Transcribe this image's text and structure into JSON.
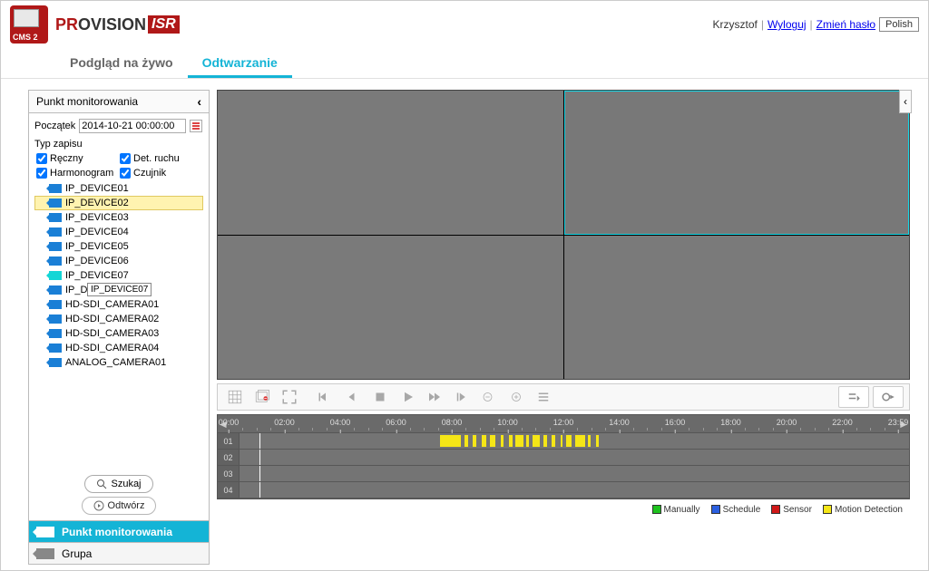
{
  "header": {
    "user": "Krzysztof",
    "logout": "Wyloguj",
    "change_pw": "Zmień hasło",
    "language": "Polish"
  },
  "tabs": {
    "live": "Podgląd na żywo",
    "playback": "Odtwarzanie"
  },
  "sidebar": {
    "title": "Punkt monitorowania",
    "start_label": "Początek",
    "start_value": "2014-10-21 00:00:00",
    "rec_type_label": "Typ zapisu",
    "types": {
      "manual": "Ręczny",
      "motion": "Det. ruchu",
      "schedule": "Harmonogram",
      "sensor": "Czujnik"
    },
    "devices": [
      "IP_DEVICE01",
      "IP_DEVICE02",
      "IP_DEVICE03",
      "IP_DEVICE04",
      "IP_DEVICE05",
      "IP_DEVICE06",
      "IP_DEVICE07",
      "IP_DEV",
      "HD-SDI_CAMERA01",
      "HD-SDI_CAMERA02",
      "HD-SDI_CAMERA03",
      "HD-SDI_CAMERA04",
      "ANALOG_CAMERA01"
    ],
    "tooltip": "IP_DEVICE07",
    "search_btn": "Szukaj",
    "play_btn": "Odtwórz",
    "tab_point": "Punkt monitorowania",
    "tab_group": "Grupa"
  },
  "timeline": {
    "ticks": [
      "00:00",
      "02:00",
      "04:00",
      "06:00",
      "08:00",
      "10:00",
      "12:00",
      "14:00",
      "16:00",
      "18:00",
      "20:00",
      "22:00",
      "23:59"
    ],
    "rows": [
      "01",
      "02",
      "03",
      "04"
    ],
    "marker_pct": 3.0,
    "segments_row1": [
      [
        30.0,
        33.0
      ],
      [
        33.6,
        34.2
      ],
      [
        34.8,
        35.4
      ],
      [
        36.2,
        36.8
      ],
      [
        37.4,
        38.2
      ],
      [
        39.0,
        39.4
      ],
      [
        40.2,
        40.8
      ],
      [
        41.2,
        42.4
      ],
      [
        42.8,
        43.2
      ],
      [
        43.8,
        44.8
      ],
      [
        45.4,
        46.0
      ],
      [
        46.6,
        47.2
      ],
      [
        48.0,
        48.3
      ],
      [
        48.8,
        49.6
      ],
      [
        50.2,
        51.6
      ],
      [
        52.0,
        52.4
      ],
      [
        53.2,
        53.6
      ]
    ]
  },
  "legend": {
    "manual": "Manually",
    "schedule": "Schedule",
    "sensor": "Sensor",
    "motion": "Motion Detection",
    "colors": {
      "manual": "#1ec21e",
      "schedule": "#2b5fe0",
      "sensor": "#d01818",
      "motion": "#f5e617"
    }
  }
}
